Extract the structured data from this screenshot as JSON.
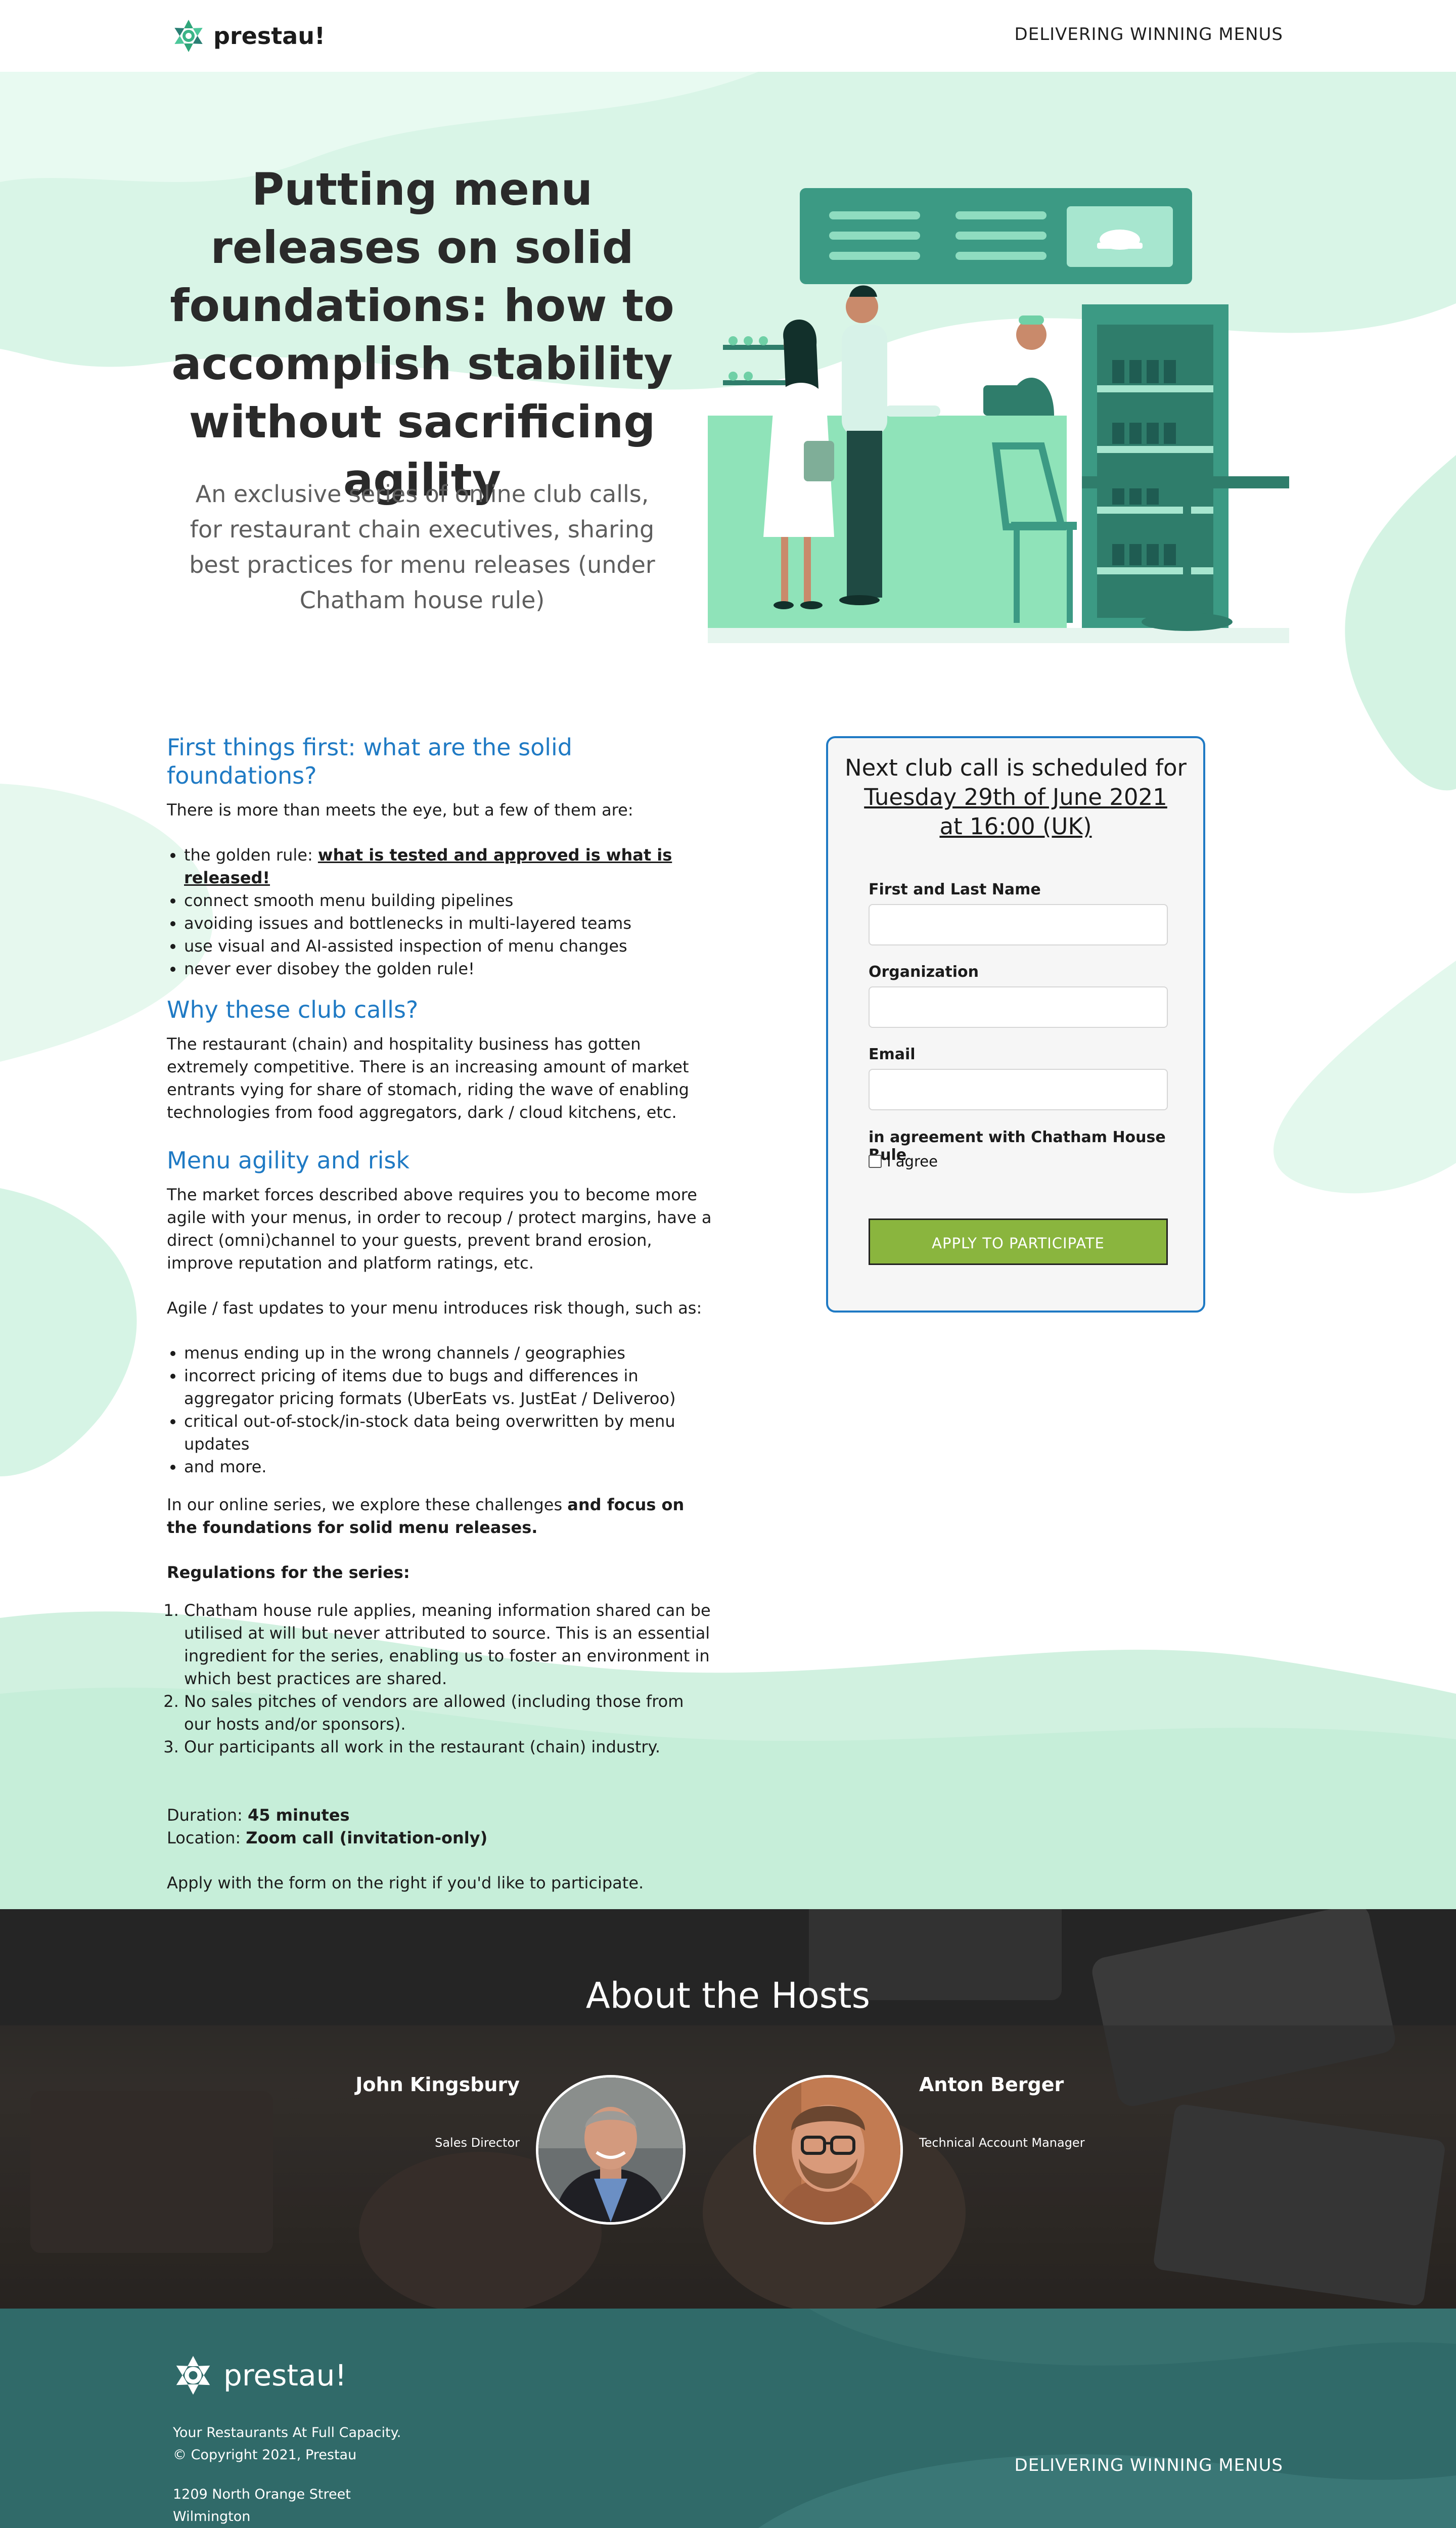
{
  "header": {
    "logo_text": "prestau!",
    "tagline": "DELIVERING WINNING MENUS"
  },
  "hero": {
    "title": "Putting menu releases on solid foundations: how to accomplish stability without sacrificing agility",
    "subtitle": "An exclusive series of online club calls, for restaurant chain executives, sharing best practices for menu releases (under Chatham house rule)"
  },
  "content": {
    "h_first": "First things first: what are the solid foundations?",
    "p_intro": "There is more than meets the eye, but a few of them are:",
    "golden_prefix": "the golden rule: ",
    "golden_rule": "what is tested and approved is what is released!",
    "foundations": [
      "connect smooth menu building pipelines",
      "avoiding issues and bottlenecks in multi-layered teams",
      "use visual and AI-assisted inspection of menu changes",
      "never ever disobey the golden rule!"
    ],
    "h_why": "Why these club calls?",
    "p_why": "The restaurant (chain) and hospitality business has gotten extremely competitive. There is an increasing amount of market entrants vying for share of stomach, riding the wave of enabling technologies from food aggregators, dark / cloud kitchens, etc.",
    "h_agility": "Menu agility and risk",
    "p_agility": "The market forces described above requires you to become more agile with your menus, in order to recoup / protect margins, have a direct (omni)channel to your guests, prevent brand erosion, improve reputation and platform ratings, etc.",
    "p_risk": "Agile / fast updates to your menu introduces risk though, such as:",
    "risks": [
      "menus ending up in the wrong channels / geographies",
      "incorrect pricing of items due to bugs and differences in aggregator pricing formats (UberEats vs. JustEat / Deliveroo)",
      "critical out-of-stock/in-stock data being overwritten by menu updates",
      "and more."
    ],
    "p_series_prefix": "In our online series, we explore these challenges ",
    "p_series_bold": "and focus on the foundations for solid menu releases.",
    "regulations_title": "Regulations for the series:",
    "regulations": [
      "Chatham house rule applies, meaning information shared can be utilised at will but never attributed to source. This is an essential ingredient for the series, enabling us to foster an environment in which best practices are shared.",
      "No sales pitches of vendors are allowed (including those from our hosts and/or sponsors).",
      "Our participants all work in the restaurant (chain) industry."
    ],
    "duration_label": "Duration: ",
    "duration_value": "45 minutes",
    "location_label": "Location: ",
    "location_value": "Zoom call (invitation-only)",
    "p_apply": "Apply with the form on the right if you'd like to participate."
  },
  "form": {
    "heading": "Next club call is scheduled for",
    "date_line1": "Tuesday 29th of June 2021",
    "date_line2": "at 16:00 (UK)",
    "name_label": "First and Last Name",
    "org_label": "Organization",
    "email_label": "Email",
    "agreement_label": "in agreement with Chatham House Rule",
    "agree_text": "I agree",
    "submit_label": "APPLY TO PARTICIPATE",
    "name_value": "",
    "org_value": "",
    "email_value": ""
  },
  "hosts": {
    "title": "About the Hosts",
    "host1_name": "John Kingsbury",
    "host1_role": "Sales Director",
    "host2_name": "Anton Berger",
    "host2_role": "Technical Account Manager"
  },
  "footer": {
    "logo_text": "prestau!",
    "line1": "Your Restaurants At Full Capacity.",
    "line2": "© Copyright 2021, Prestau",
    "line3": "1209 North Orange Street",
    "line4": "Wilmington",
    "tagline": "DELIVERING WINNING MENUS"
  },
  "colors": {
    "accent_blue": "#1f7ac4",
    "mint": "#d2f3e2",
    "teal": "#306a69",
    "button_green": "#8ab53e"
  }
}
